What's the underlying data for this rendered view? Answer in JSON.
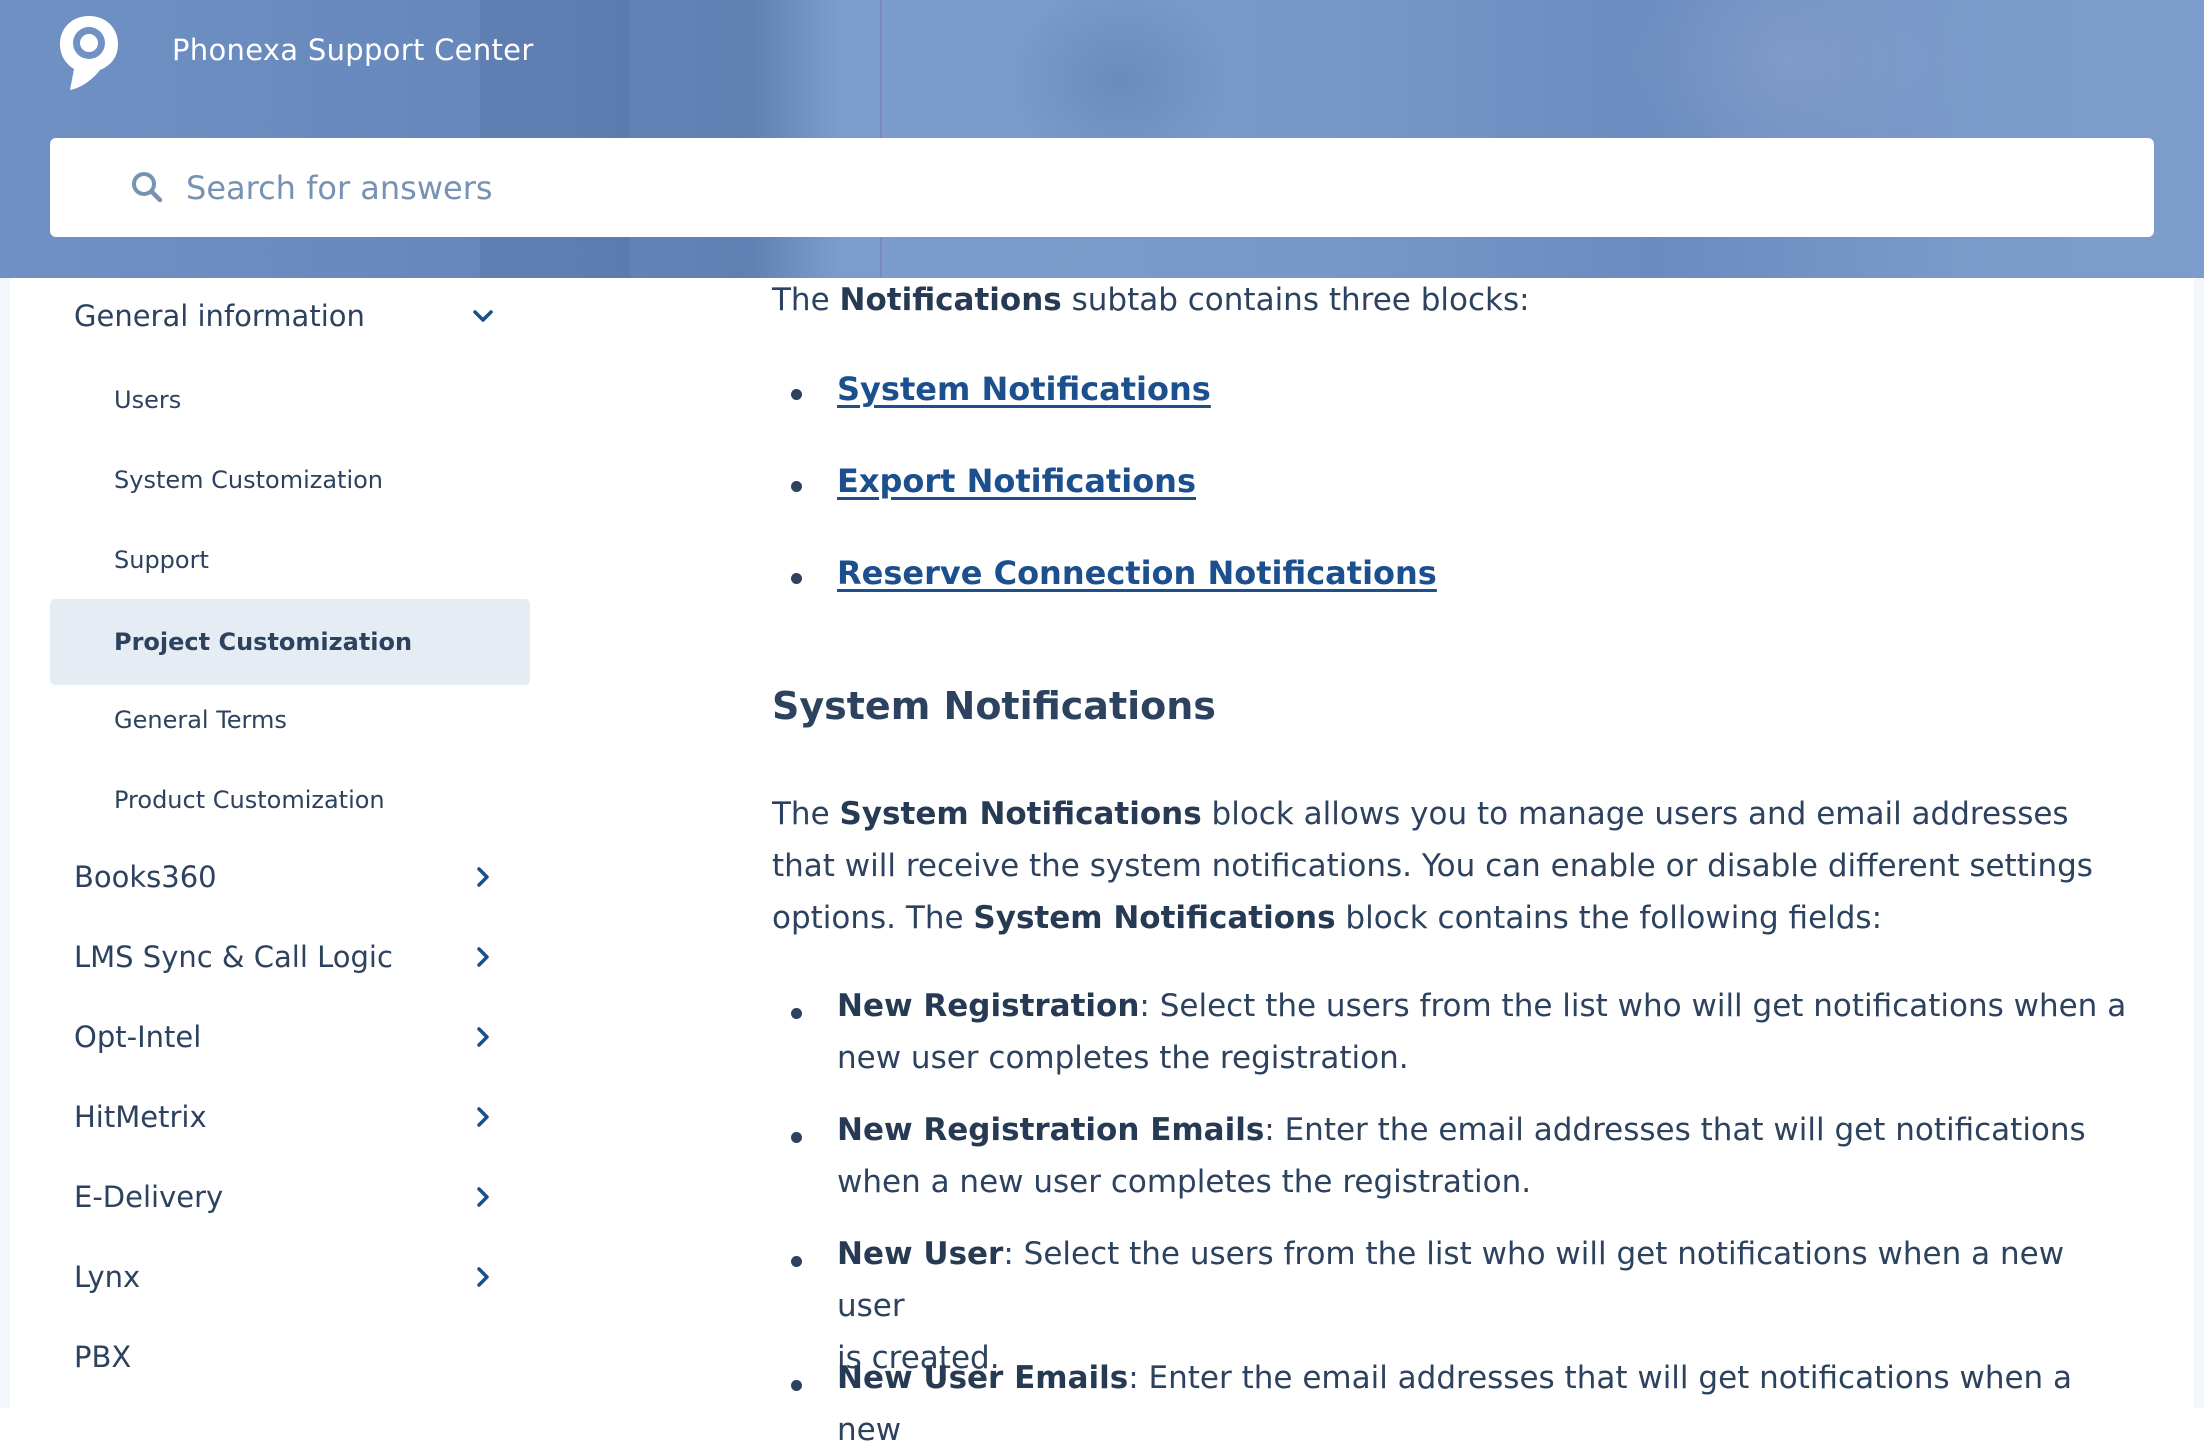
{
  "header": {
    "site_title": "Phonexa Support Center",
    "logo_icon": "chat-bubble-logo-icon",
    "search": {
      "placeholder": "Search for answers",
      "value": "",
      "icon": "search-icon"
    }
  },
  "sidebar": {
    "expanded_section": {
      "label": "General information",
      "icon": "chevron-down-icon",
      "items": [
        {
          "label": "Users",
          "active": false
        },
        {
          "label": "System Customization",
          "active": false
        },
        {
          "label": "Support",
          "active": false
        },
        {
          "label": "Project Customization",
          "active": true
        },
        {
          "label": "General Terms",
          "active": false
        },
        {
          "label": "Product Customization",
          "active": false
        }
      ]
    },
    "sections": [
      {
        "label": "Books360",
        "icon": "chevron-right-icon"
      },
      {
        "label": "LMS Sync & Call Logic",
        "icon": "chevron-right-icon"
      },
      {
        "label": "Opt-Intel",
        "icon": "chevron-right-icon"
      },
      {
        "label": "HitMetrix",
        "icon": "chevron-right-icon"
      },
      {
        "label": "E-Delivery",
        "icon": "chevron-right-icon"
      },
      {
        "label": "Lynx",
        "icon": "chevron-right-icon"
      },
      {
        "label": "PBX",
        "icon": ""
      }
    ]
  },
  "article": {
    "intro": {
      "pre": "The ",
      "bold": "Notifications",
      "post": " subtab contains three blocks:"
    },
    "block_links": [
      "System Notifications",
      "Export Notifications",
      "Reserve Connection Notifications"
    ],
    "section_heading": "System Notifications",
    "section_paragraph": {
      "l1_pre": "The ",
      "l1_bold": "System Notifications",
      "l1_post": " block allows you to manage users and email addresses",
      "l2": "that will receive the system notifications. You can enable or disable different settings",
      "l3_pre": "options. The ",
      "l3_bold": "System Notifications",
      "l3_post": " block contains the following fields:"
    },
    "fields": [
      {
        "name": "New Registration",
        "desc_l1": ": Select the users from the list who will get notifications when a",
        "desc_l2": "new user completes the registration."
      },
      {
        "name": "New Registration Emails",
        "desc_l1": ": Enter the email addresses that will get notifications",
        "desc_l2": "when a new user completes the registration."
      },
      {
        "name": "New User",
        "desc_l1": ": Select the users from the list who will get notifications when a new user",
        "desc_l2": "is created."
      },
      {
        "name": "New User Emails",
        "desc_l1": ": Enter the email addresses that will get notifications when a new",
        "desc_l2": ""
      }
    ]
  },
  "colors": {
    "header_blue": "#7b9ccc",
    "text": "#2c425e",
    "link": "#1c4f8e",
    "chevron": "#1b4f8a",
    "active_item_bg": "#e6ecf4",
    "placeholder": "#7892b4"
  }
}
